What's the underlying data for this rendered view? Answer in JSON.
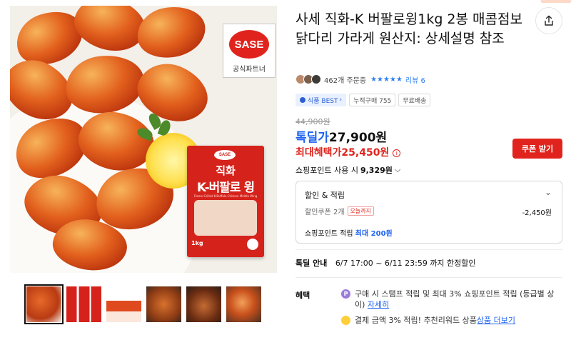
{
  "product": {
    "title": "사세 직화-K 버팔로윙1kg 2봉 매콤점보닭다리 가라게 원산지: 상세설명 참조",
    "order_count": "462개 주문중",
    "review_label": "리뷰 6",
    "stars": "★★★★★"
  },
  "image": {
    "brand_logo": "SASE",
    "brand_partner": "공식파트너",
    "pack_logo": "SASE",
    "pack_title1": "직화",
    "pack_title2": "K-버팔로 윙",
    "pack_sub": "Flame-Grilled K-Buffalo Chicken Middle Wing",
    "pack_weight": "1kg"
  },
  "badges": [
    {
      "icon": "ad-icon",
      "label": "식품 BEST"
    },
    {
      "label": "누적구매 755"
    },
    {
      "label": "무료배송"
    }
  ],
  "price": {
    "original": "44,900원",
    "sale_label": "톡딜가",
    "sale_value": "27,900원",
    "max_label": "최대혜택가",
    "max_value": "25,450원",
    "coupon_button": "쿠폰 받기",
    "points_text": "쇼핑포인트 사용 시",
    "points_value": "9,329원"
  },
  "discount": {
    "title": "할인 & 적립",
    "coupon_label": "할인쿠폰 2개",
    "coupon_tag": "오늘까지",
    "coupon_amount": "-2,450원",
    "points_label": "쇼핑포인트 적립",
    "points_value": "최대 200원"
  },
  "deal": {
    "label": "톡딜 안내",
    "text": "6/7 17:00 ~ 6/11 23:59 까지 한정할인"
  },
  "benefit": {
    "label": "혜택",
    "line1": "구매 시 스탬프 적립 및 최대 3% 쇼핑포인트 적립 (등급별 상이) ",
    "line1_link": "자세히",
    "line2": "결제 금액 3% 적립! 추천리워드 상품 ",
    "line2_link": "상품 더보기"
  },
  "colors": {
    "accent_blue": "#1e63ef",
    "accent_red": "#e0241d",
    "star_blue": "#2d7ff0"
  }
}
